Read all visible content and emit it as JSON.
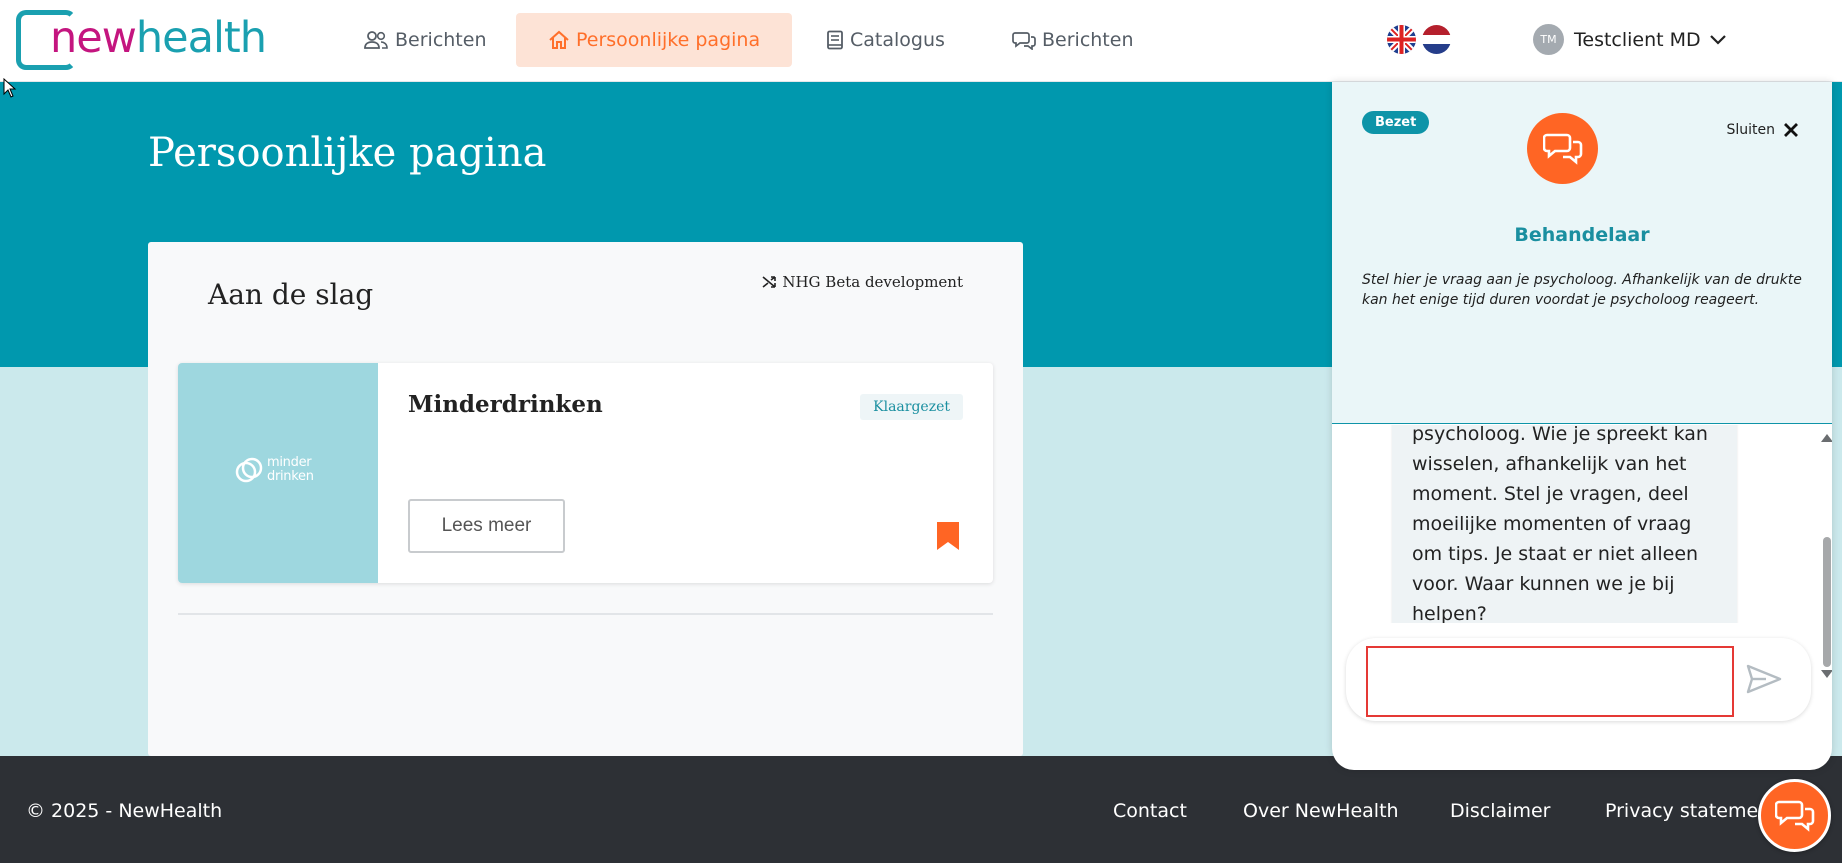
{
  "brand": {
    "logo_new": "new",
    "logo_health": "health"
  },
  "nav": {
    "items": [
      {
        "label": "Berichten",
        "icon": "users-icon"
      },
      {
        "label": "Persoonlijke pagina",
        "icon": "home-icon",
        "active": true
      },
      {
        "label": "Catalogus",
        "icon": "book-icon"
      },
      {
        "label": "Berichten",
        "icon": "chat-icon"
      }
    ]
  },
  "languages": [
    "English",
    "Nederlands"
  ],
  "user": {
    "initials": "TM",
    "name": "Testclient MD"
  },
  "page": {
    "title": "Persoonlijke pagina"
  },
  "panel": {
    "title": "Aan de slag",
    "environment": "NHG Beta development",
    "program": {
      "title": "Minderdrinken",
      "status": "Klaargezet",
      "thumb_line1": "minder",
      "thumb_line2": "drinken",
      "button": "Lees meer"
    }
  },
  "footer": {
    "copyright": "© 2025 - NewHealth",
    "links": [
      "Contact",
      "Over NewHealth",
      "Disclaimer",
      "Privacy statement"
    ]
  },
  "chat": {
    "status_badge": "Bezet",
    "close_label": "Sluiten",
    "role": "Behandelaar",
    "description": "Stel hier je vraag aan je psycholoog. Afhankelijk van de drukte kan het enige tijd duren voordat je psycholoog reageert.",
    "message": "psycholoog. Wie je spreekt kan wisselen, afhankelijk van het moment. Stel je vragen, deel moeilijke momenten of vraag om tips. Je staat er niet alleen voor. Waar kunnen we je bij helpen?",
    "input_value": ""
  },
  "colors": {
    "brand_teal": "#0098ae",
    "brand_magenta": "#c4157f",
    "accent_orange": "#ff6524",
    "footer_bg": "#2d3035"
  }
}
